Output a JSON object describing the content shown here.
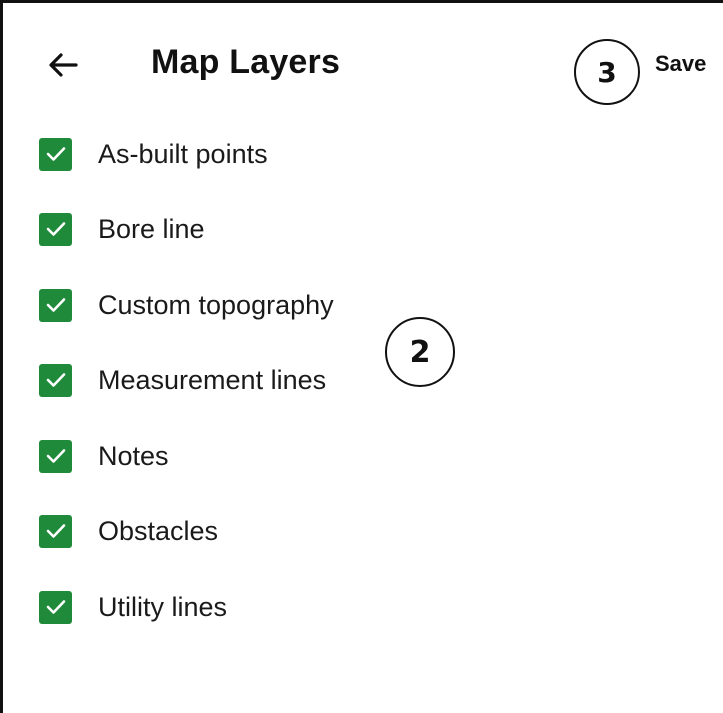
{
  "header": {
    "back_icon": "arrow-left-icon",
    "title": "Map Layers",
    "save_label": "Save"
  },
  "callouts": {
    "save_marker": "3",
    "list_marker": "2"
  },
  "layers": [
    {
      "label": "As-built points",
      "checked": true
    },
    {
      "label": "Bore line",
      "checked": true
    },
    {
      "label": "Custom topography",
      "checked": true
    },
    {
      "label": "Measurement lines",
      "checked": true
    },
    {
      "label": "Notes",
      "checked": true
    },
    {
      "label": "Obstacles",
      "checked": true
    },
    {
      "label": "Utility lines",
      "checked": true
    }
  ],
  "colors": {
    "checkbox_checked": "#1e8a3a",
    "checkmark": "#ffffff",
    "text": "#1a1a1a",
    "frame_border": "#111111"
  }
}
